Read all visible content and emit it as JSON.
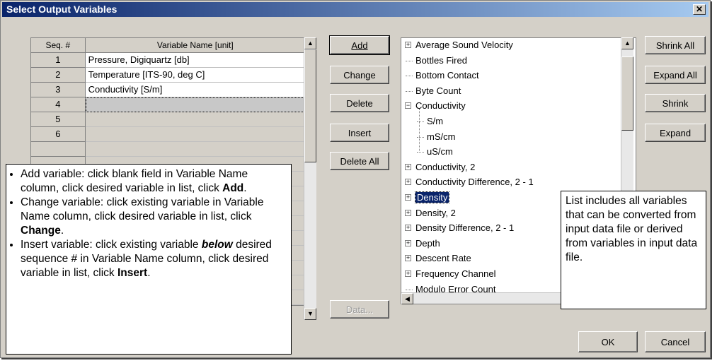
{
  "window": {
    "title": "Select Output Variables",
    "close_glyph": "✕"
  },
  "table": {
    "headers": [
      "Seq. #",
      "Variable Name [unit]"
    ],
    "rows": [
      {
        "seq": "1",
        "name": "Pressure, Digiquartz [db]"
      },
      {
        "seq": "2",
        "name": "Temperature [ITS-90, deg C]"
      },
      {
        "seq": "3",
        "name": "Conductivity [S/m]"
      },
      {
        "seq": "4",
        "name": ""
      },
      {
        "seq": "5",
        "name": ""
      },
      {
        "seq": "6",
        "name": ""
      }
    ]
  },
  "buttons": {
    "add": "Add",
    "change": "Change",
    "delete": "Delete",
    "insert": "Insert",
    "delete_all": "Delete All",
    "data": "Data...",
    "shrink_all": "Shrink All",
    "expand_all": "Expand All",
    "shrink": "Shrink",
    "expand": "Expand",
    "ok": "OK",
    "cancel": "Cancel"
  },
  "tree": {
    "items": [
      {
        "label": "Average Sound Velocity",
        "expander": "+"
      },
      {
        "label": "Bottles Fired",
        "expander": ""
      },
      {
        "label": "Bottom Contact",
        "expander": ""
      },
      {
        "label": "Byte Count",
        "expander": ""
      },
      {
        "label": "Conductivity",
        "expander": "−"
      },
      {
        "label": "S/m",
        "expander": ""
      },
      {
        "label": "mS/cm",
        "expander": ""
      },
      {
        "label": "uS/cm",
        "expander": ""
      },
      {
        "label": "Conductivity, 2",
        "expander": "+"
      },
      {
        "label": "Conductivity Difference, 2 - 1",
        "expander": "+"
      },
      {
        "label": "Density",
        "expander": "+"
      },
      {
        "label": "Density, 2",
        "expander": "+"
      },
      {
        "label": "Density Difference, 2 - 1",
        "expander": "+"
      },
      {
        "label": "Depth",
        "expander": "+"
      },
      {
        "label": "Descent Rate",
        "expander": "+"
      },
      {
        "label": "Frequency Channel",
        "expander": "+"
      },
      {
        "label": "Modulo Error Count",
        "expander": ""
      }
    ]
  },
  "callout_left": {
    "items": [
      {
        "a": "Add variable: click blank field in Variable Name column, click desired variable in list, click ",
        "b": "Add",
        "c": "."
      },
      {
        "a": "Change variable: click existing variable in Variable Name column, click desired variable in list, click ",
        "b": "Change",
        "c": "."
      },
      {
        "a": "Insert variable: click existing variable ",
        "em": "below",
        "a2": " desired sequence # in Variable Name column, click desired variable in list, click ",
        "b": "Insert",
        "c": "."
      }
    ]
  },
  "callout_right": {
    "text": "List includes all variables that can be converted from input data file or derived from variables in input data file."
  }
}
